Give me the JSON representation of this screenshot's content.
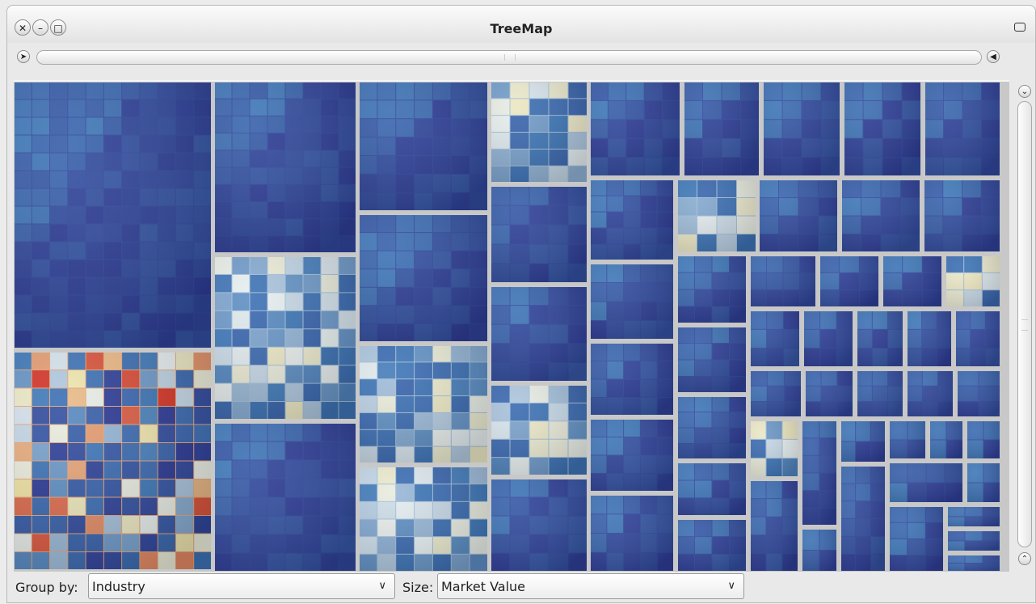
{
  "window": {
    "title": "TreeMap",
    "close_glyph": "✕",
    "minimize_glyph": "–",
    "restore_glyph": "□"
  },
  "scrollbars": {
    "left_arrow": "➤",
    "right_arrow": "◀",
    "up_arrow": "⌄",
    "down_arrow": "⌃"
  },
  "controls": {
    "group_by_label": "Group by:",
    "group_by_value": "Industry",
    "size_label": "Size:",
    "size_value": "Market Value",
    "dropdown_arrow": "∨"
  },
  "colors": {
    "low": "#2b3591",
    "mid": "#3f78b8",
    "neutral": "#e6eef0",
    "warm": "#efe2a4",
    "high": "#d0291e",
    "border": "#c8c8c8"
  }
}
